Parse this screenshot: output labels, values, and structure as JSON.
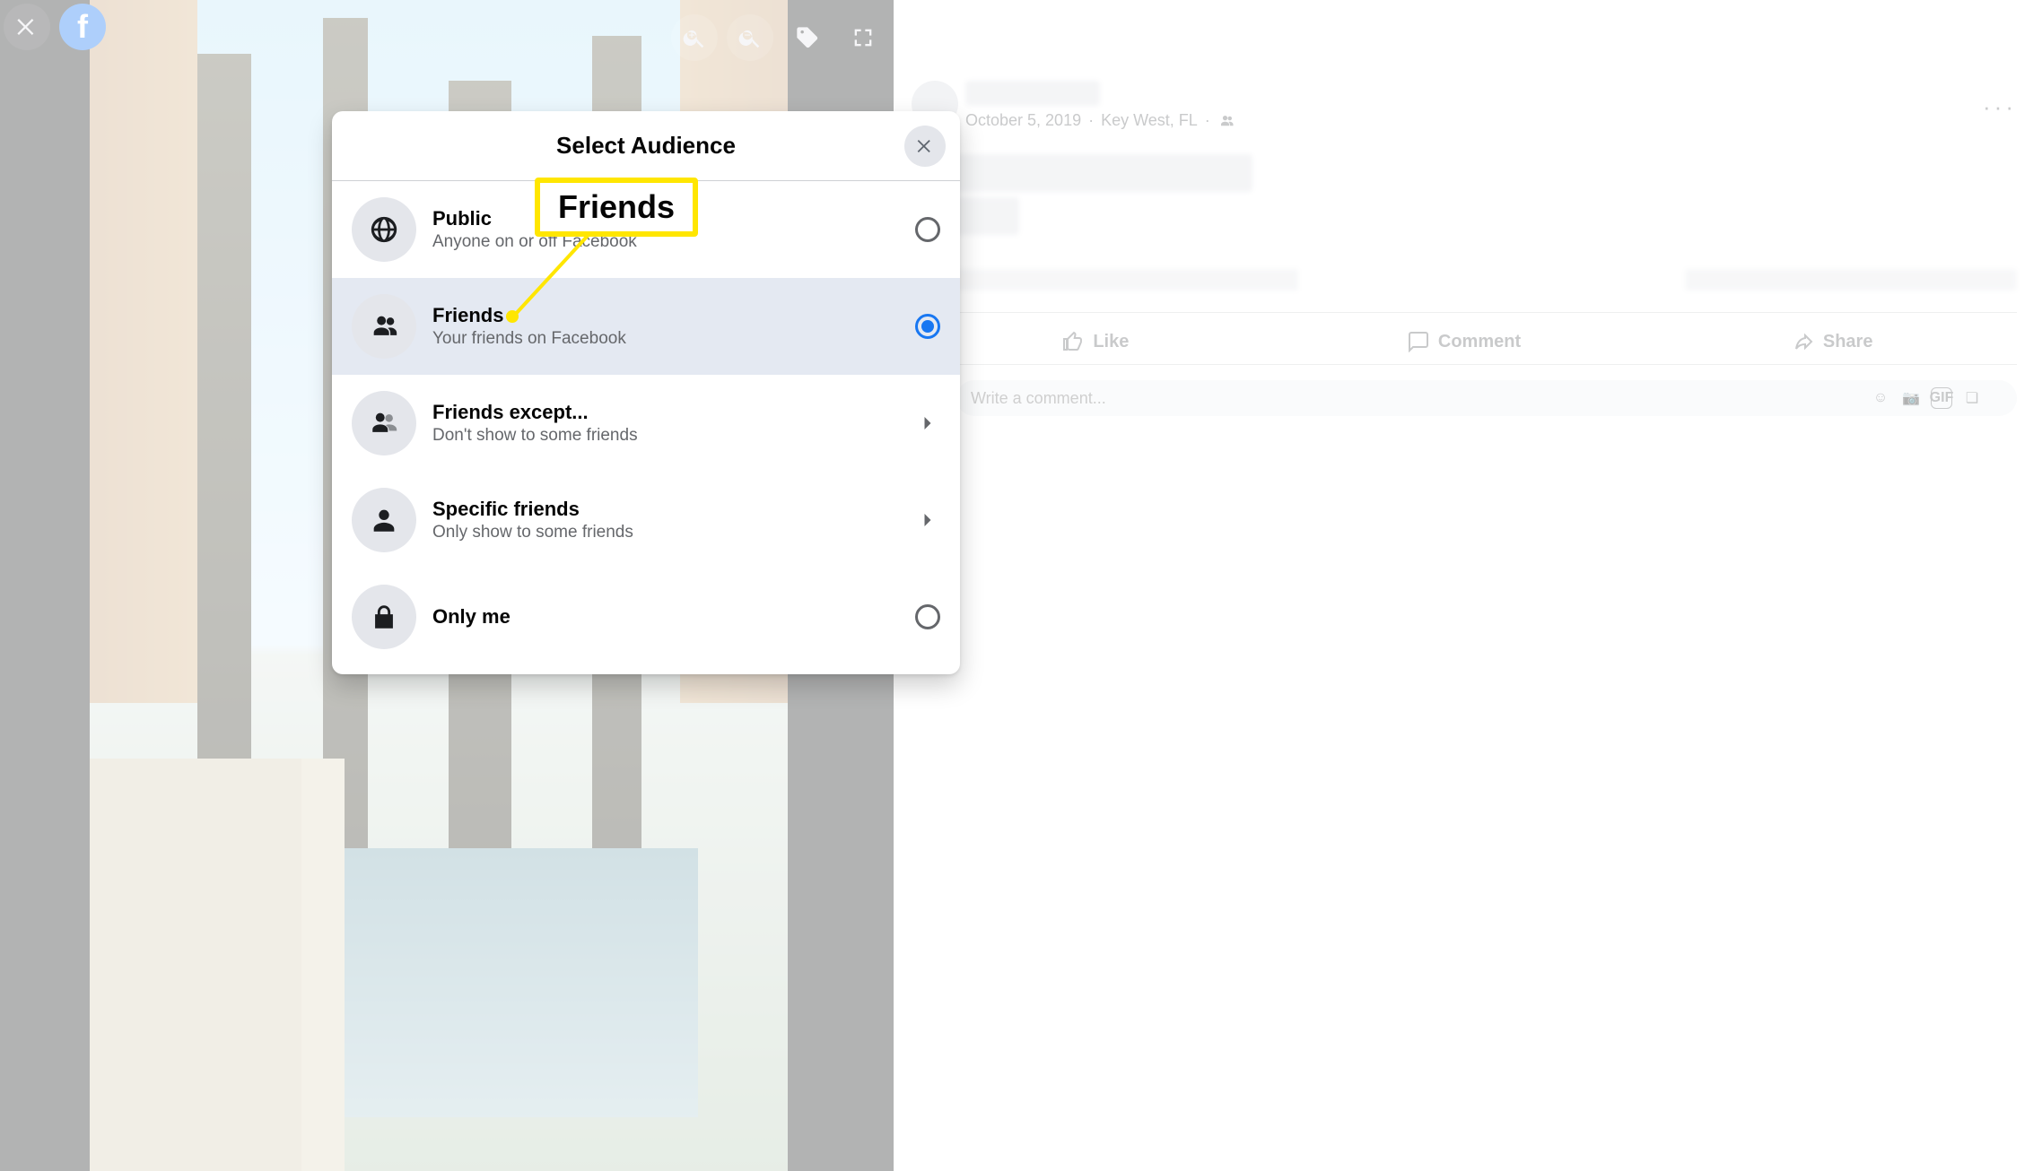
{
  "viewer": {
    "icons": {
      "close": "close-icon",
      "logo_letter": "f",
      "zoom_in": "zoom-in-icon",
      "zoom_out": "zoom-out-icon",
      "tag": "tag-icon",
      "fullscreen": "fullscreen-icon"
    }
  },
  "header_icons": {
    "plus": "plus-icon",
    "messenger": "messenger-icon",
    "notifications": "bell-icon",
    "account": "caret-down-icon"
  },
  "post": {
    "date": "October 5, 2019",
    "location": "Key West, FL",
    "options_glyph": "···",
    "actions": {
      "like": "Like",
      "comment": "Comment",
      "share": "Share"
    },
    "comment_placeholder": "Write a comment...",
    "gif_label": "GIF"
  },
  "modal": {
    "title": "Select Audience",
    "options": [
      {
        "id": "public",
        "title": "Public",
        "sub": "Anyone on or off Facebook",
        "icon": "globe-icon",
        "right": "radio",
        "selected": false
      },
      {
        "id": "friends",
        "title": "Friends",
        "sub": "Your friends on Facebook",
        "icon": "friends-icon",
        "right": "radio",
        "selected": true
      },
      {
        "id": "friends-except",
        "title": "Friends except...",
        "sub": "Don't show to some friends",
        "icon": "friends-minus-icon",
        "right": "chevron"
      },
      {
        "id": "specific",
        "title": "Specific friends",
        "sub": "Only show to some friends",
        "icon": "person-icon",
        "right": "chevron"
      },
      {
        "id": "only-me",
        "title": "Only me",
        "sub": "",
        "icon": "lock-icon",
        "right": "radio",
        "selected": false
      }
    ]
  },
  "annotation": {
    "label": "Friends"
  }
}
